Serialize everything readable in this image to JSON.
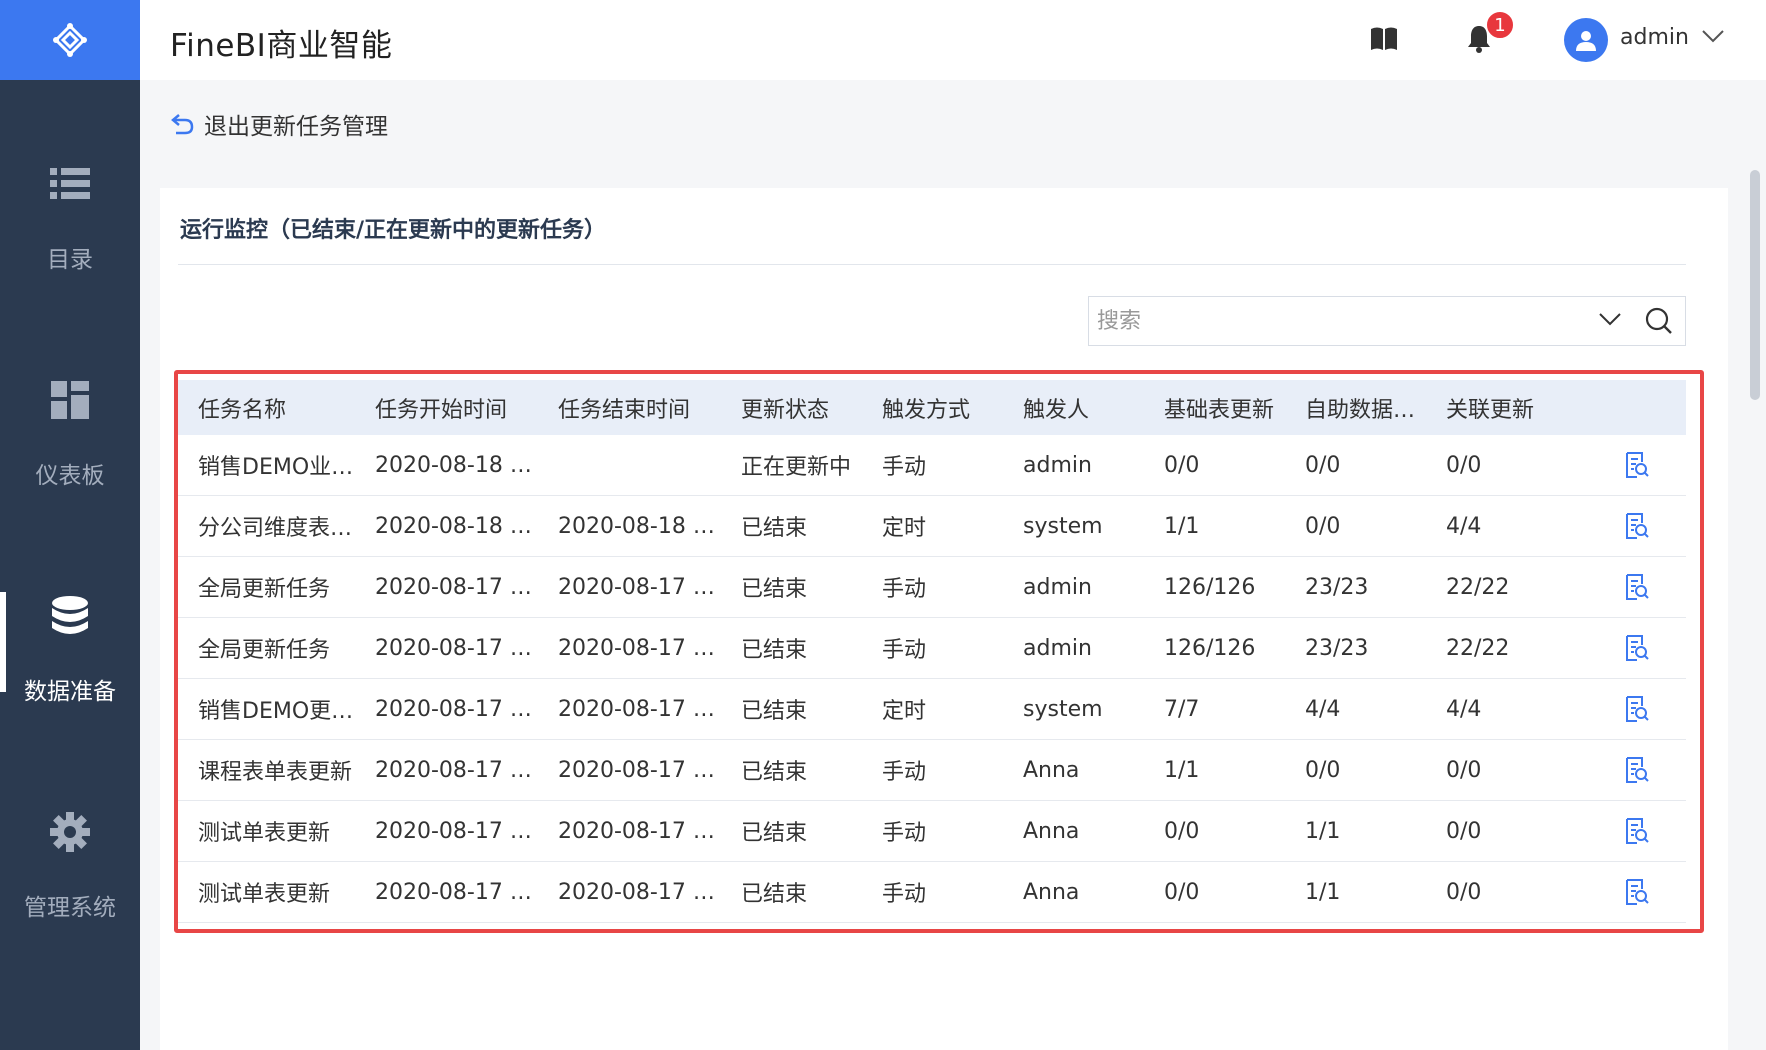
{
  "app": {
    "title": "FineBI商业智能",
    "accent_color": "#3c78f0",
    "sidebar_color": "#2b3a50",
    "highlight_color": "#e84646"
  },
  "header": {
    "notification_count": "1",
    "user_name": "admin",
    "icons": [
      "book-icon",
      "bell-icon",
      "user-avatar-icon",
      "chevron-down-icon"
    ]
  },
  "sidebar": {
    "items": [
      {
        "label": "目录",
        "icon": "list-icon",
        "active": false
      },
      {
        "label": "仪表板",
        "icon": "dashboard-grid-icon",
        "active": false
      },
      {
        "label": "数据准备",
        "icon": "database-icon",
        "active": true
      },
      {
        "label": "管理系统",
        "icon": "gear-icon",
        "active": false
      }
    ]
  },
  "back_link": {
    "label": "退出更新任务管理",
    "icon": "back-arrow-icon"
  },
  "panel": {
    "title": "运行监控（已结束/正在更新中的更新任务）",
    "search_placeholder": "搜索"
  },
  "table": {
    "headers": [
      "任务名称",
      "任务开始时间",
      "任务结束时间",
      "更新状态",
      "触发方式",
      "触发人",
      "基础表更新",
      "自助数据…",
      "关联更新",
      ""
    ],
    "rows": [
      [
        "销售DEMO业…",
        "2020-08-18 …",
        "",
        "正在更新中",
        "手动",
        "admin",
        "0/0",
        "0/0",
        "0/0"
      ],
      [
        "分公司维度表…",
        "2020-08-18 …",
        "2020-08-18 …",
        "已结束",
        "定时",
        "system",
        "1/1",
        "0/0",
        "4/4"
      ],
      [
        "全局更新任务",
        "2020-08-17 …",
        "2020-08-17 …",
        "已结束",
        "手动",
        "admin",
        "126/126",
        "23/23",
        "22/22"
      ],
      [
        "全局更新任务",
        "2020-08-17 …",
        "2020-08-17 …",
        "已结束",
        "手动",
        "admin",
        "126/126",
        "23/23",
        "22/22"
      ],
      [
        "销售DEMO更…",
        "2020-08-17 …",
        "2020-08-17 …",
        "已结束",
        "定时",
        "system",
        "7/7",
        "4/4",
        "4/4"
      ],
      [
        "课程表单表更新",
        "2020-08-17 …",
        "2020-08-17 …",
        "已结束",
        "手动",
        "Anna",
        "1/1",
        "0/0",
        "0/0"
      ],
      [
        "测试单表更新",
        "2020-08-17 …",
        "2020-08-17 …",
        "已结束",
        "手动",
        "Anna",
        "0/0",
        "1/1",
        "0/0"
      ],
      [
        "测试单表更新",
        "2020-08-17 …",
        "2020-08-17 …",
        "已结束",
        "手动",
        "Anna",
        "0/0",
        "1/1",
        "0/0"
      ]
    ],
    "row_action_icon": "log-detail-icon"
  }
}
